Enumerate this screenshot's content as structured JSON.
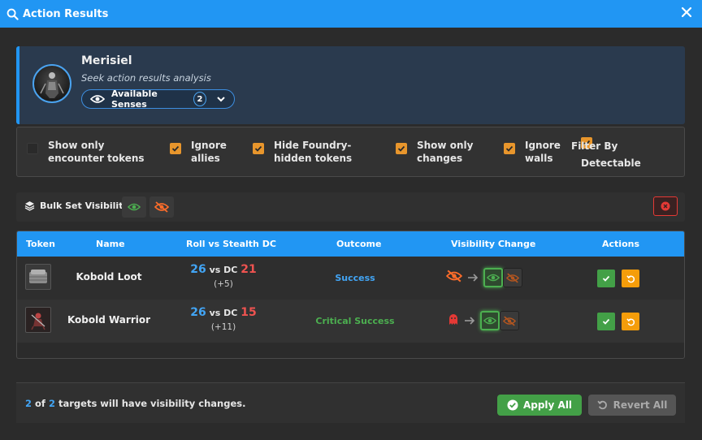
{
  "window": {
    "title": "Action Results"
  },
  "header": {
    "actor_name": "Merisiel",
    "subtitle": "Seek action results analysis",
    "senses_label": "Available Senses",
    "senses_count": "2"
  },
  "filters": [
    {
      "label": "Show only encounter tokens",
      "checked": false
    },
    {
      "label": "Ignore allies",
      "checked": true
    },
    {
      "label": "Hide Foundry-hidden tokens",
      "checked": true
    },
    {
      "label": "Show only changes",
      "checked": true
    },
    {
      "label": "Ignore walls",
      "checked": true
    },
    {
      "label": "Filter By Detectable",
      "checked": true
    }
  ],
  "bulk": {
    "label": "Bulk Set Visibility"
  },
  "table": {
    "columns": [
      "Token",
      "Name",
      "Roll vs Stealth DC",
      "Outcome",
      "Visibility Change",
      "Actions"
    ],
    "rows": [
      {
        "name": "Kobold Loot",
        "roll": "26",
        "vs": "vs DC",
        "dc": "21",
        "mod": "(+5)",
        "outcome": "Success",
        "outcome_color": "#42a5f5",
        "from_icon": "eye-slash-icon"
      },
      {
        "name": "Kobold Warrior",
        "roll": "26",
        "vs": "vs DC",
        "dc": "15",
        "mod": "(+11)",
        "outcome": "Critical Success",
        "outcome_color": "#4caf50",
        "from_icon": "ghost-icon"
      }
    ]
  },
  "footer": {
    "changed": "2",
    "of": "of",
    "total": "2",
    "suffix": "targets will have visibility changes.",
    "apply_all": "Apply All",
    "revert_all": "Revert All"
  },
  "colors": {
    "accent": "#2196f3",
    "success": "#43a047",
    "warning": "#f59d0a",
    "danger": "#e53935",
    "checkbox": "#e8962c"
  }
}
